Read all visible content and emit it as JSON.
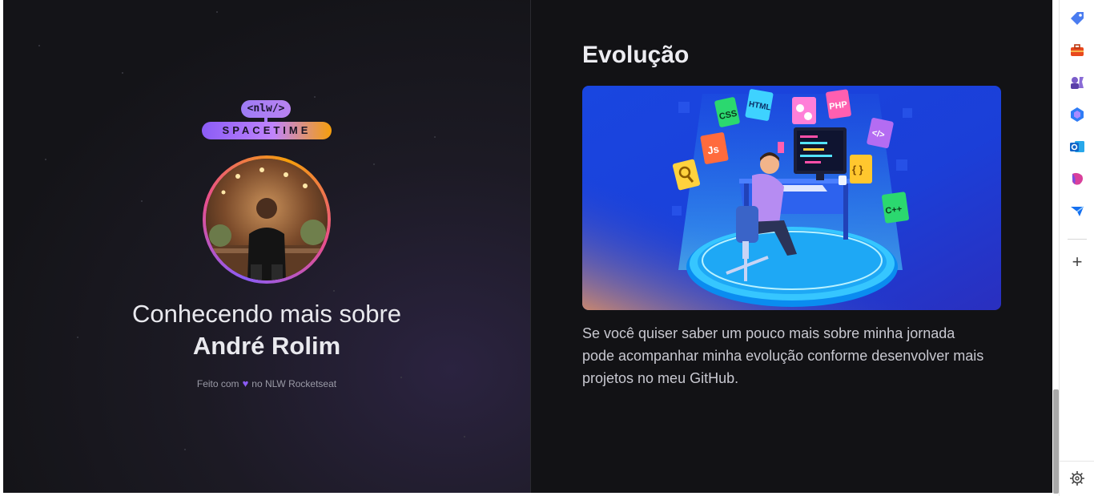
{
  "left": {
    "logo": {
      "tag": "<nlw/>",
      "wordmark": "SPACETIME"
    },
    "intro_line": "Conhecendo mais sobre",
    "name": "André Rolim",
    "footer_prefix": "Feito com",
    "footer_heart": "♥",
    "footer_suffix": "no NLW Rocketseat"
  },
  "right": {
    "heading": "Evolução",
    "illustration_badges": [
      "CSS",
      "HTML",
      "PHP",
      "</>",
      "Js",
      "{ }",
      "C++"
    ],
    "description": "Se você quiser saber um pouco mais sobre minha jornada pode acompanhar minha evolução conforme desenvolver mais projetos no meu GitHub."
  },
  "sidebar": {
    "icons": [
      "tag-icon",
      "toolbox-icon",
      "games-icon",
      "copilot-icon",
      "outlook-icon",
      "drop-icon",
      "send-icon",
      "add-icon",
      "settings-icon"
    ],
    "add_label": "+"
  },
  "colors": {
    "accent_purple": "#8b5cf6",
    "accent_orange": "#f59e0b",
    "background": "#121215"
  }
}
